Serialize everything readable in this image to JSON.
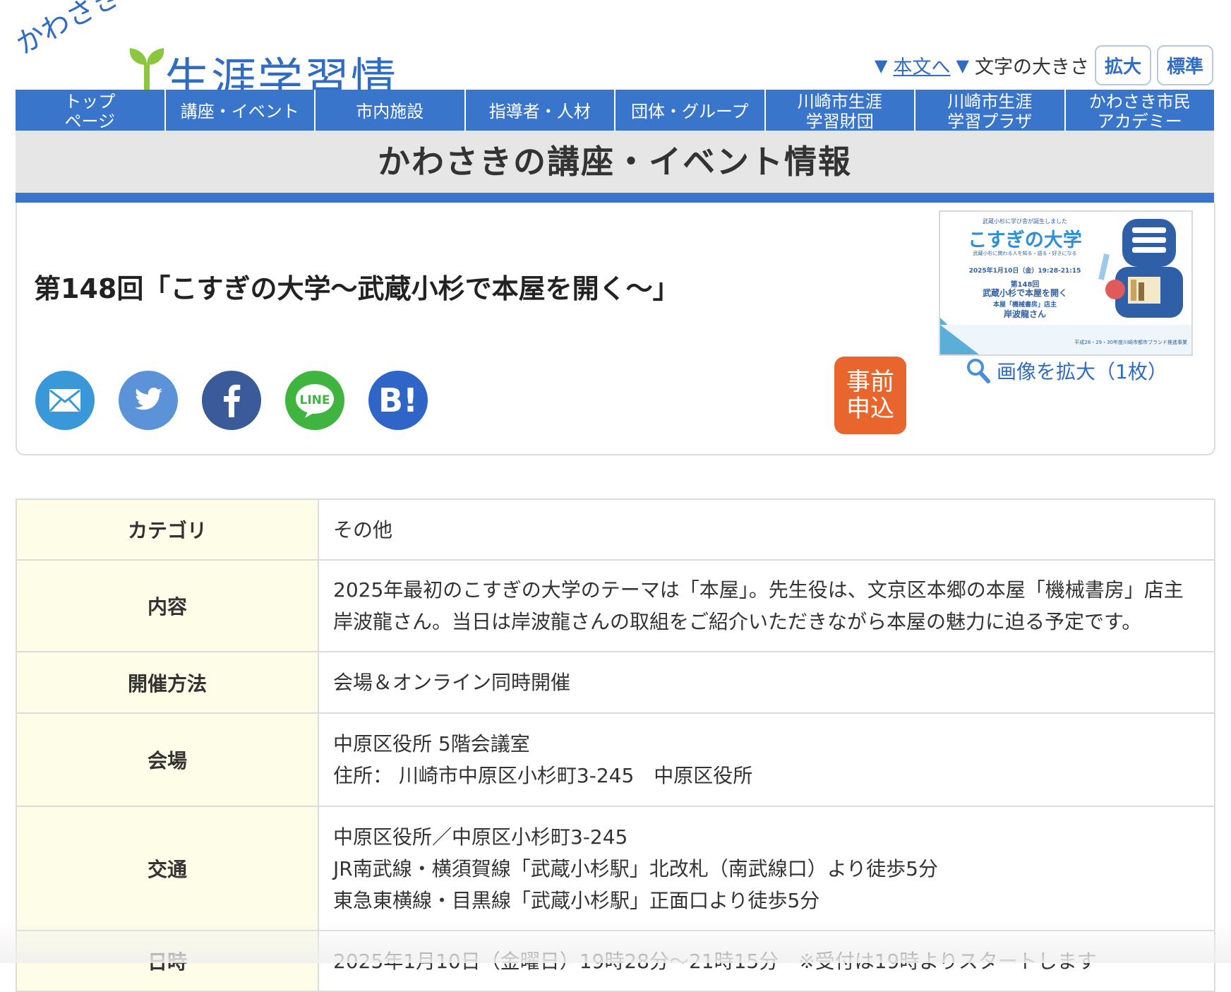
{
  "header": {
    "logo_kana": "かわさきの",
    "logo_title": "生涯学習情報",
    "skip_link": "本文へ",
    "text_size_label": "文字の大きさ",
    "enlarge_label": "拡大",
    "standard_label": "標準"
  },
  "nav": {
    "items": [
      {
        "label": "トップページ"
      },
      {
        "label": "講座・イベント"
      },
      {
        "label": "市内施設"
      },
      {
        "label": "指導者・人材"
      },
      {
        "label": "団体・グループ"
      },
      {
        "label": "川崎市生涯学習財団"
      },
      {
        "label": "川崎市生涯学習プラザ"
      },
      {
        "label": "かわさき市民アカデミー"
      }
    ]
  },
  "banner": {
    "title": "かわさきの講座・イベント情報"
  },
  "event": {
    "title": "第148回「こすぎの大学〜武蔵小杉で本屋を開く〜」",
    "apply_button": "事前申込",
    "zoom_link": "画像を拡大（1枚）",
    "thumbnail": {
      "top_line": "武蔵小杉に学び舎が誕生しました",
      "brand": "こすぎの大学",
      "sub_line": "武蔵小杉に関わる人を知る・語る・好きになる",
      "date_line": "2025年1月10日（金）19:28-21:15",
      "session": "第148回",
      "topic": "武蔵小杉で本屋を開く",
      "speaker_role": "本屋「機械書房」店主",
      "speaker": "岸波龍さん",
      "footer": "平成28・29・30年度川崎市都市ブランド推進事業"
    }
  },
  "social": {
    "line_label": "LINE",
    "hatena_label": "B!"
  },
  "colors": {
    "nav_blue": "#3a75cc",
    "apply_orange": "#e8652d",
    "header_cell_bg": "#fdfde8"
  },
  "details": {
    "rows": [
      {
        "label": "カテゴリ",
        "lines": [
          "その他"
        ]
      },
      {
        "label": "内容",
        "lines": [
          "2025年最初のこすぎの大学のテーマは「本屋」。先生役は、文京区本郷の本屋「機械書房」店主岸波龍さん。当日は岸波龍さんの取組をご紹介いただきながら本屋の魅力に迫る予定です。"
        ]
      },
      {
        "label": "開催方法",
        "lines": [
          "会場＆オンライン同時開催"
        ]
      },
      {
        "label": "会場",
        "lines": [
          "中原区役所 5階会議室",
          "住所： 川崎市中原区小杉町3-245　中原区役所"
        ]
      },
      {
        "label": "交通",
        "lines": [
          "中原区役所／中原区小杉町3-245",
          "JR南武線・横須賀線「武蔵小杉駅」北改札（南武線口）より徒歩5分",
          "東急東横線・目黒線「武蔵小杉駅」正面口より徒歩5分"
        ]
      },
      {
        "label": "日時",
        "lines": [
          "2025年1月10日（金曜日）19時28分〜21時15分　※受付は19時よりスタートします"
        ]
      }
    ]
  }
}
